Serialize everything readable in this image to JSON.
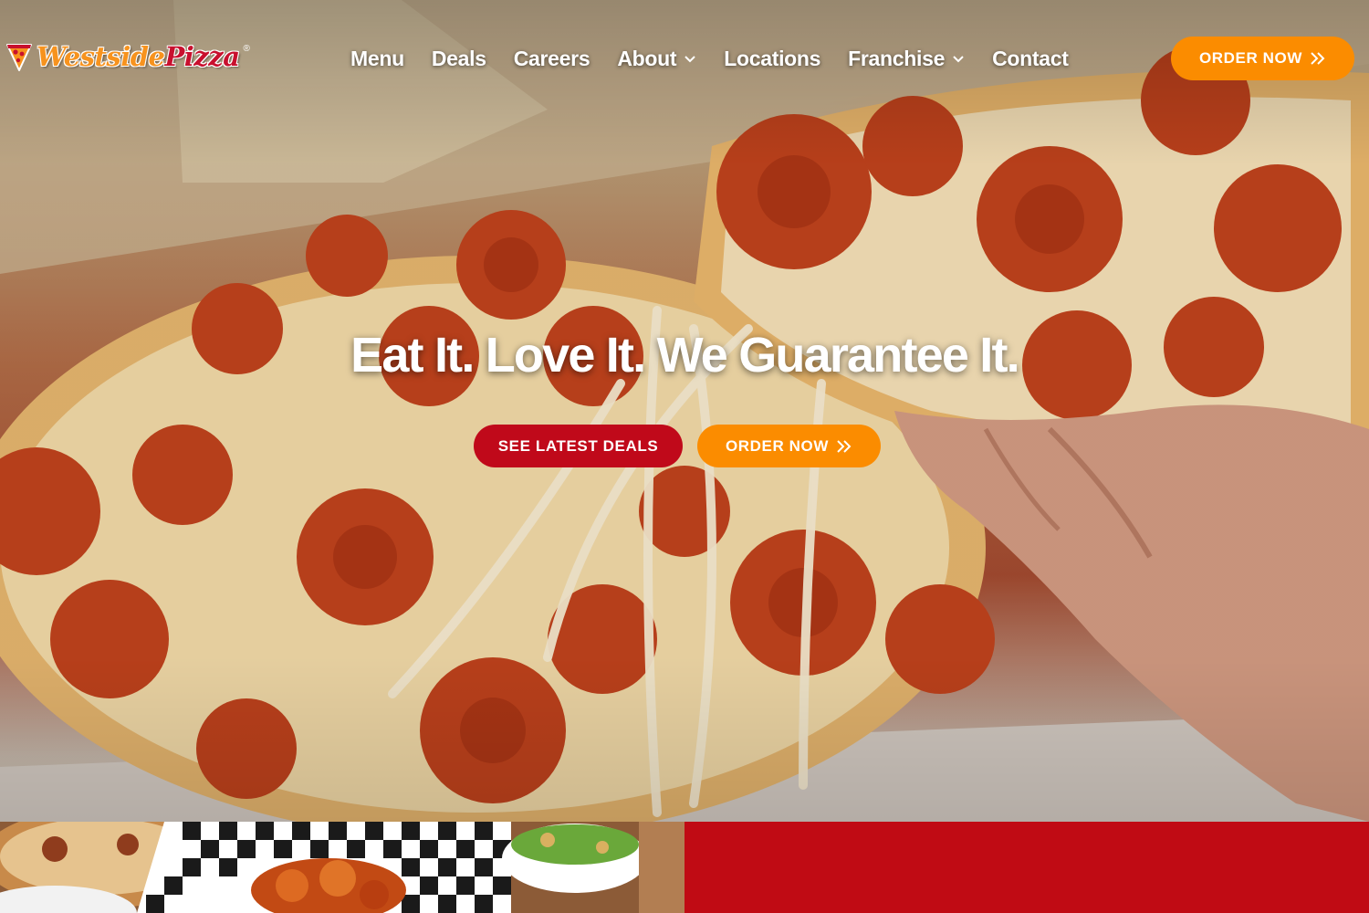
{
  "brand": {
    "logo_text_primary": "Westside",
    "logo_text_secondary": "Pizza",
    "logo_registered": "®",
    "colors": {
      "orange": "#fb8c00",
      "red": "#c0091a",
      "white": "#ffffff"
    }
  },
  "nav": {
    "items": [
      {
        "label": "Menu",
        "has_dropdown": false
      },
      {
        "label": "Deals",
        "has_dropdown": false
      },
      {
        "label": "Careers",
        "has_dropdown": false
      },
      {
        "label": "About",
        "has_dropdown": true
      },
      {
        "label": "Locations",
        "has_dropdown": false
      },
      {
        "label": "Franchise",
        "has_dropdown": true
      },
      {
        "label": "Contact",
        "has_dropdown": false
      }
    ],
    "order_button": {
      "label": "ORDER NOW",
      "icon": "double-chevron-right-icon"
    }
  },
  "hero": {
    "headline": "Eat It. Love It. We Guarantee It.",
    "deals_button": {
      "label": "SEE LATEST DEALS"
    },
    "order_button": {
      "label": "ORDER NOW",
      "icon": "double-chevron-right-icon"
    }
  }
}
